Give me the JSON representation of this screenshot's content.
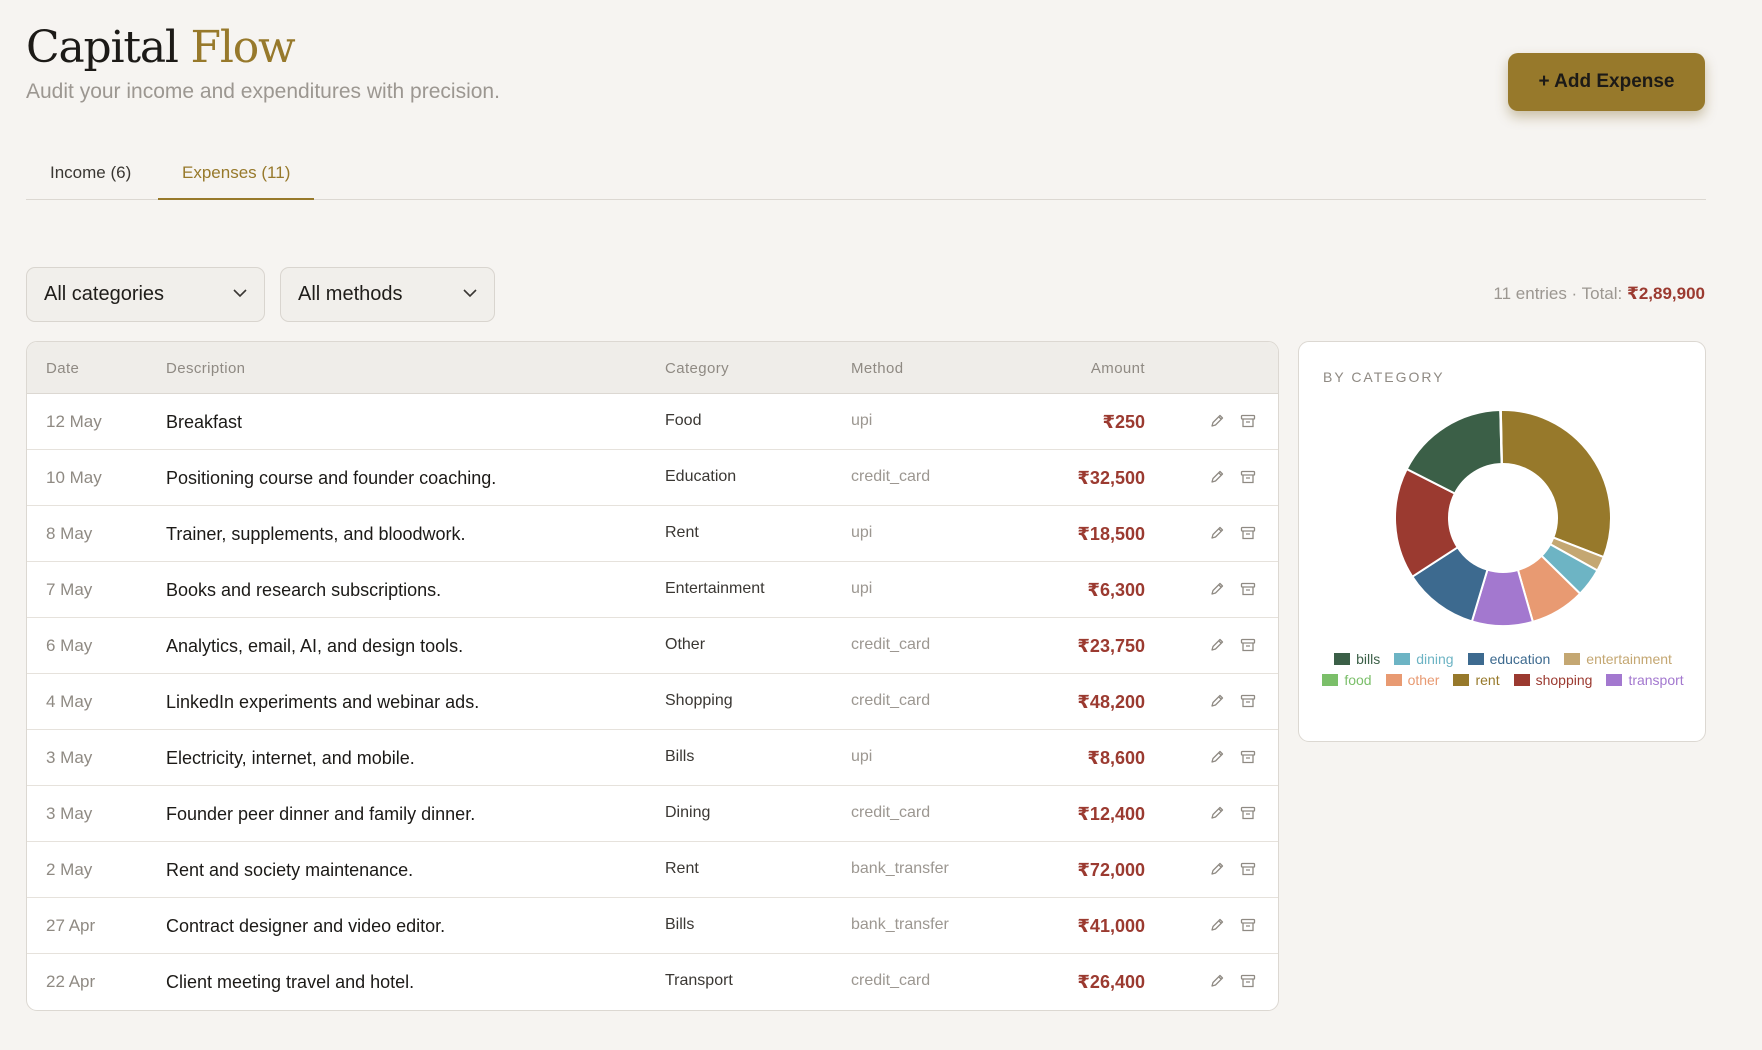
{
  "header": {
    "title_main": "Capital",
    "title_accent": "Flow",
    "subtitle": "Audit your income and expenditures with precision.",
    "add_button": "+ Add Expense"
  },
  "tabs": [
    {
      "label": "Income (6)",
      "active": false
    },
    {
      "label": "Expenses (11)",
      "active": true
    }
  ],
  "filters": {
    "category": "All categories",
    "method": "All methods"
  },
  "summary": {
    "entries_label": "11 entries · Total:",
    "total": "₹2,89,900"
  },
  "table": {
    "columns": [
      "Date",
      "Description",
      "Category",
      "Method",
      "Amount"
    ],
    "rows": [
      {
        "date": "12 May",
        "description": "Breakfast",
        "category": "Food",
        "method": "upi",
        "amount": "₹250"
      },
      {
        "date": "10 May",
        "description": "Positioning course and founder coaching.",
        "category": "Education",
        "method": "credit_card",
        "amount": "₹32,500"
      },
      {
        "date": "8 May",
        "description": "Trainer, supplements, and bloodwork.",
        "category": "Rent",
        "method": "upi",
        "amount": "₹18,500"
      },
      {
        "date": "7 May",
        "description": "Books and research subscriptions.",
        "category": "Entertainment",
        "method": "upi",
        "amount": "₹6,300"
      },
      {
        "date": "6 May",
        "description": "Analytics, email, AI, and design tools.",
        "category": "Other",
        "method": "credit_card",
        "amount": "₹23,750"
      },
      {
        "date": "4 May",
        "description": "LinkedIn experiments and webinar ads.",
        "category": "Shopping",
        "method": "credit_card",
        "amount": "₹48,200"
      },
      {
        "date": "3 May",
        "description": "Electricity, internet, and mobile.",
        "category": "Bills",
        "method": "upi",
        "amount": "₹8,600"
      },
      {
        "date": "3 May",
        "description": "Founder peer dinner and family dinner.",
        "category": "Dining",
        "method": "credit_card",
        "amount": "₹12,400"
      },
      {
        "date": "2 May",
        "description": "Rent and society maintenance.",
        "category": "Rent",
        "method": "bank_transfer",
        "amount": "₹72,000"
      },
      {
        "date": "27 Apr",
        "description": "Contract designer and video editor.",
        "category": "Bills",
        "method": "bank_transfer",
        "amount": "₹41,000"
      },
      {
        "date": "22 Apr",
        "description": "Client meeting travel and hotel.",
        "category": "Transport",
        "method": "credit_card",
        "amount": "₹26,400"
      }
    ]
  },
  "chart": {
    "title": "BY CATEGORY"
  },
  "chart_data": {
    "type": "pie",
    "donut": true,
    "title": "BY CATEGORY",
    "legend_position": "bottom",
    "slices": [
      {
        "name": "rent",
        "value": 90500,
        "color": "#97792b"
      },
      {
        "name": "entertainment",
        "value": 6300,
        "color": "#c4a772"
      },
      {
        "name": "dining",
        "value": 12400,
        "color": "#6db4c4"
      },
      {
        "name": "other",
        "value": 23750,
        "color": "#e89a72"
      },
      {
        "name": "transport",
        "value": 26400,
        "color": "#a378cf"
      },
      {
        "name": "education",
        "value": 32500,
        "color": "#3d6a8f"
      },
      {
        "name": "shopping",
        "value": 48200,
        "color": "#9b3a30"
      },
      {
        "name": "bills",
        "value": 49600,
        "color": "#3b5f47"
      },
      {
        "name": "food",
        "value": 250,
        "color": "#7bbf6a"
      }
    ],
    "legend": [
      {
        "name": "bills",
        "color": "#3b5f47"
      },
      {
        "name": "dining",
        "color": "#6db4c4"
      },
      {
        "name": "education",
        "color": "#3d6a8f"
      },
      {
        "name": "entertainment",
        "color": "#c4a772"
      },
      {
        "name": "food",
        "color": "#7bbf6a"
      },
      {
        "name": "other",
        "color": "#e89a72"
      },
      {
        "name": "rent",
        "color": "#97792b"
      },
      {
        "name": "shopping",
        "color": "#9b3a30"
      },
      {
        "name": "transport",
        "color": "#a378cf"
      }
    ]
  },
  "icons": {
    "edit": "pencil-icon",
    "delete": "archive-icon",
    "dropdown": "chevron-down-icon"
  },
  "colors": {
    "accent": "#97792b",
    "amount": "#9b3a30",
    "background": "#f6f4f1"
  }
}
